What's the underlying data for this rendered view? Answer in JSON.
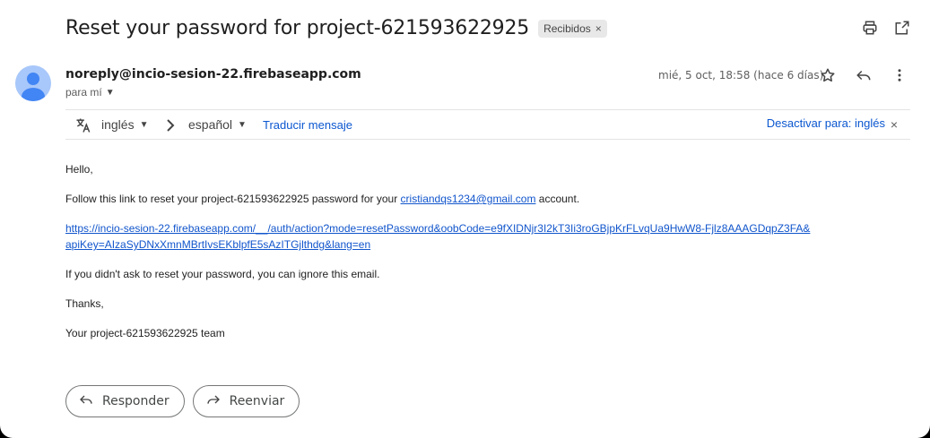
{
  "email": {
    "subject": "Reset your password for project-621593622925",
    "label": "Recibidos",
    "sender": "noreply@incio-sesion-22.firebaseapp.com",
    "to": "para mí",
    "date": "mié, 5 oct, 18:58 (hace 6 días)"
  },
  "translate": {
    "from_lang": "inglés",
    "to_lang": "español",
    "translate_label": "Traducir mensaje",
    "disable_label": "Desactivar para: inglés"
  },
  "body": {
    "greeting": "Hello,",
    "line1_pre": "Follow this link to reset your project-621593622925 password for your ",
    "line1_email": "cristiandqs1234@gmail.com",
    "line1_post": " account.",
    "link_part1": "https://incio-sesion-22.firebaseapp.com/__/auth/action?mode=resetPassword&oobCode=e9fXIDNjr3I2kT3Ii3roGBjpKrFLvqUa9HwW8-Fjlz8AAAGDqpZ3FA&",
    "link_part2": "apiKey=AIzaSyDNxXmnMBrtIvsEKblpfE5sAzITGjlthdg&lang=en",
    "line_ignore": "If you didn't ask to reset your password, you can ignore this email.",
    "thanks": "Thanks,",
    "signature": "Your project-621593622925 team"
  },
  "actions": {
    "reply": "Responder",
    "forward": "Reenviar"
  },
  "icons": {
    "print": "print-icon",
    "open_new": "open-in-new-icon",
    "star": "star-icon",
    "reply": "reply-icon",
    "more": "more-vert-icon",
    "translate": "translate-icon"
  }
}
